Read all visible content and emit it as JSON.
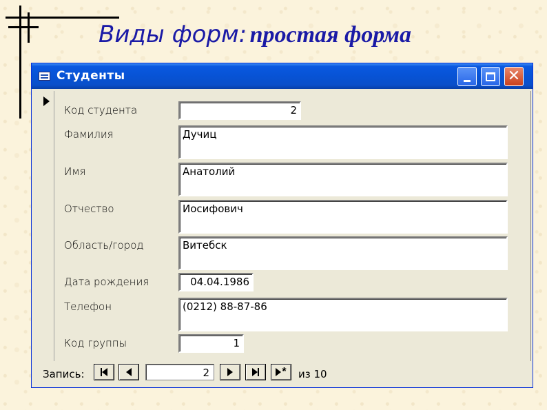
{
  "slide": {
    "title_part1": "Виды форм:",
    "title_part2": "простая форма"
  },
  "window": {
    "title": "Студенты",
    "icon": "form-icon"
  },
  "fields": [
    {
      "label": "Код студента",
      "value": "2"
    },
    {
      "label": "Фамилия",
      "value": "Дучиц"
    },
    {
      "label": "Имя",
      "value": "Анатолий"
    },
    {
      "label": "Отчество",
      "value": "Иосифович"
    },
    {
      "label": "Область/город",
      "value": "Витебск"
    },
    {
      "label": "Дата рождения",
      "value": "04.04.1986"
    },
    {
      "label": "Телефон",
      "value": "(0212) 88-87-86"
    },
    {
      "label": "Код группы",
      "value": "1"
    }
  ],
  "navigation": {
    "label": "Запись:",
    "current": "2",
    "of_label": "из",
    "total": "10"
  },
  "colors": {
    "title_text": "#1a1aa6",
    "titlebar": "#0753d5",
    "window_bg": "#ece9d8"
  }
}
